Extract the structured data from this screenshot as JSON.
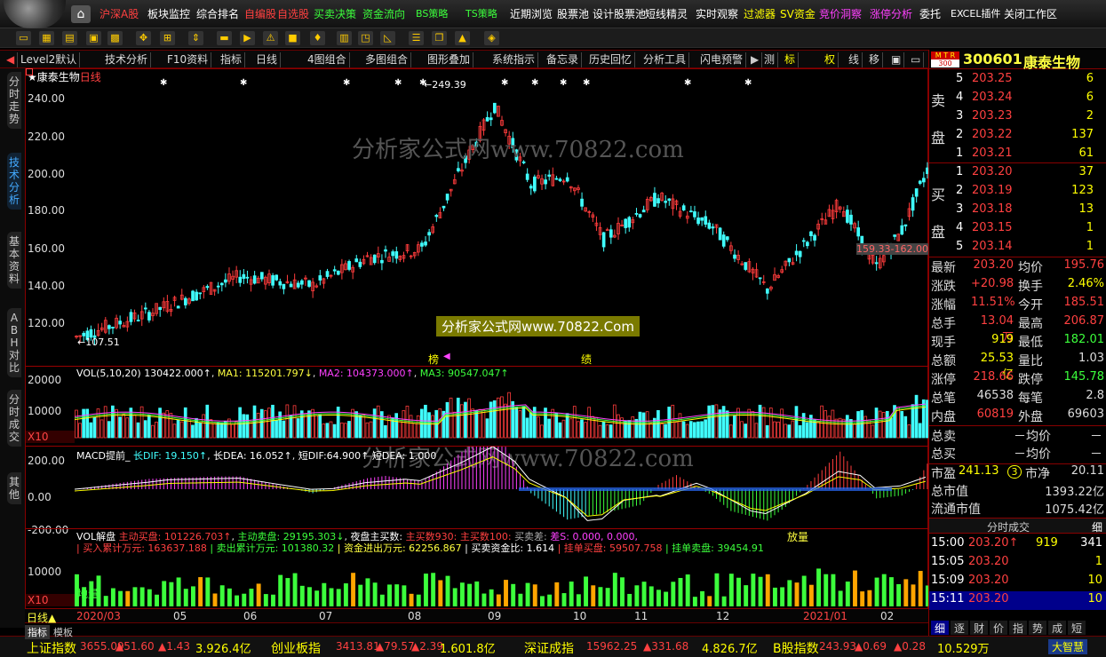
{
  "menu": {
    "items": [
      "沪深A股",
      "板块监控",
      "综合排名",
      "自编股",
      "自选股",
      "买卖决策",
      "资金流向",
      "BS策略",
      "TS策略",
      "近期浏览",
      "股票池",
      "设计股票池",
      "短线精灵",
      "实时观察",
      "过滤器",
      "SV资金",
      "竞价洞察",
      "涨停分析",
      "委托",
      "EXCEL插件",
      "关闭工作区"
    ]
  },
  "tabs": [
    "Level2默认",
    "技术分析",
    "F10资料",
    "指标",
    "日线",
    "4图组合",
    "多图组合",
    "图形叠加",
    "系统指示",
    "备忘录",
    "历史回忆",
    "分析工具",
    "闪电预警",
    "测",
    "标",
    "权",
    "线",
    "移"
  ],
  "side_tabs": [
    "分时走势",
    "技术分析",
    "基本资料",
    "ABH对比",
    "分时成交",
    "其他"
  ],
  "chart": {
    "title": "康泰生物",
    "period": "日线",
    "price_axis": [
      "240.00",
      "220.00",
      "200.00",
      "180.00",
      "160.00",
      "140.00",
      "120.00"
    ],
    "high_label": "249.39",
    "low_label": "107.51",
    "range_label": "159.33-162.00",
    "watermark1": "分析家公式网www.70822.com",
    "watermark2": "分析家公式网www.70822.Com",
    "event_1": "榜",
    "event_2": "绩",
    "vol_header": {
      "name": "VOL(5,10,20)",
      "v": "130422.000↑",
      "ma1": "MA1: 115201.797↓",
      "ma2": "MA2: 104373.000↑",
      "ma3": "MA3: 90547.047↑"
    },
    "vol_axis": [
      "20000",
      "10000",
      "X10"
    ],
    "macd_header": {
      "name": "MACD提前_",
      "dif": "长DIF: 19.150↑",
      "dea": "长DEA: 16.052↑",
      "sdif": "短DIF:64.900↑",
      "sdea": "短DEA: 1.000",
      "end": "EA: 1.000"
    },
    "macd_axis": [
      "200.00",
      "0.00",
      "-200.00"
    ],
    "vp_header": {
      "name": "VOL解盘",
      "a": "主动买盘: 101226.703↑",
      "b": "主动卖盘: 29195.303↓",
      "c": "夜盘主买数:",
      "d": "主买数930:",
      "e": "主买数100:",
      "f": "买卖差:",
      "g": "差S: 0.000, 0.000,",
      "h": "放量"
    },
    "vp_header2": {
      "a": "买入累计万元: 163637.188",
      "b": "卖出累计万元: 101380.32",
      "c": "资金进出万元: 62256.867",
      "d": "买卖资金比: 1.614",
      "e": "挂单买盘: 59507.758",
      "f": "挂单卖盘: 39454.91"
    },
    "vp_axis": [
      "10000",
      "X10"
    ],
    "vp_label": "地量",
    "date_axis": [
      "2020/03",
      "05",
      "06",
      "07",
      "08",
      "09",
      "10",
      "11",
      "12",
      "2021/01",
      "02"
    ],
    "period_sel": "日线"
  },
  "quote": {
    "code": "300601",
    "name": "康泰生物",
    "badge_top": "M T R",
    "badge_bottom": "300",
    "sell_label": [
      "卖",
      "盘"
    ],
    "buy_label": [
      "买",
      "盘"
    ],
    "asks": [
      [
        "5",
        "203.25",
        "6"
      ],
      [
        "4",
        "203.24",
        "6"
      ],
      [
        "3",
        "203.23",
        "2"
      ],
      [
        "2",
        "203.22",
        "137"
      ],
      [
        "1",
        "203.21",
        "61"
      ]
    ],
    "bids": [
      [
        "1",
        "203.20",
        "37"
      ],
      [
        "2",
        "203.19",
        "123"
      ],
      [
        "3",
        "203.18",
        "13"
      ],
      [
        "4",
        "203.15",
        "1"
      ],
      [
        "5",
        "203.14",
        "1"
      ]
    ],
    "stats": [
      [
        "最新",
        "203.20",
        "均价",
        "195.76"
      ],
      [
        "涨跌",
        "+20.98",
        "换手",
        "2.46%"
      ],
      [
        "涨幅",
        "11.51%",
        "今开",
        "185.51"
      ],
      [
        "总手",
        "13.04万",
        "最高",
        "206.87"
      ],
      [
        "现手",
        "919",
        "最低",
        "182.01"
      ],
      [
        "总额",
        "25.53亿",
        "量比",
        "1.03"
      ],
      [
        "涨停",
        "218.66",
        "跌停",
        "145.78"
      ],
      [
        "总笔",
        "46538",
        "每笔",
        "2.8"
      ],
      [
        "内盘",
        "60819",
        "外盘",
        "69603"
      ]
    ],
    "total_sell": [
      "总卖",
      "－均价",
      "－"
    ],
    "total_buy": [
      "总买",
      "－均价",
      "－"
    ],
    "val": [
      [
        "市盈",
        "241.13",
        "3",
        "市净",
        "20.11"
      ],
      [
        "总市值",
        "1393.22亿"
      ],
      [
        "流通市值",
        "1075.42亿"
      ]
    ],
    "ticks_title": "分时成交",
    "ticks_btn": "细",
    "ticks": [
      [
        "15:00",
        "203.20↑",
        "919",
        "341"
      ],
      [
        "15:05",
        "203.20",
        "",
        "1"
      ],
      [
        "15:09",
        "203.20",
        "",
        "10"
      ],
      [
        "15:11",
        "203.20",
        "",
        "10"
      ]
    ],
    "bottom_tabs": [
      "细",
      "逐",
      "财",
      "价",
      "指",
      "势",
      "成",
      "短"
    ]
  },
  "status": {
    "tabs": [
      "指标",
      "模板"
    ],
    "items": [
      [
        "上证指数",
        "3655.09",
        "▲51.60",
        "▲1.43",
        "3.926.4亿"
      ],
      [
        "创业板指",
        "3413.81",
        "▲79.57",
        "▲2.39",
        "1.601.8亿"
      ],
      [
        "深证成指",
        "15962.25",
        "▲331.68",
        "",
        "4.826.7亿"
      ],
      [
        "B股指数",
        "243.93",
        "▲0.69",
        "▲0.28",
        "10.529万"
      ]
    ],
    "brand": "大智慧"
  }
}
